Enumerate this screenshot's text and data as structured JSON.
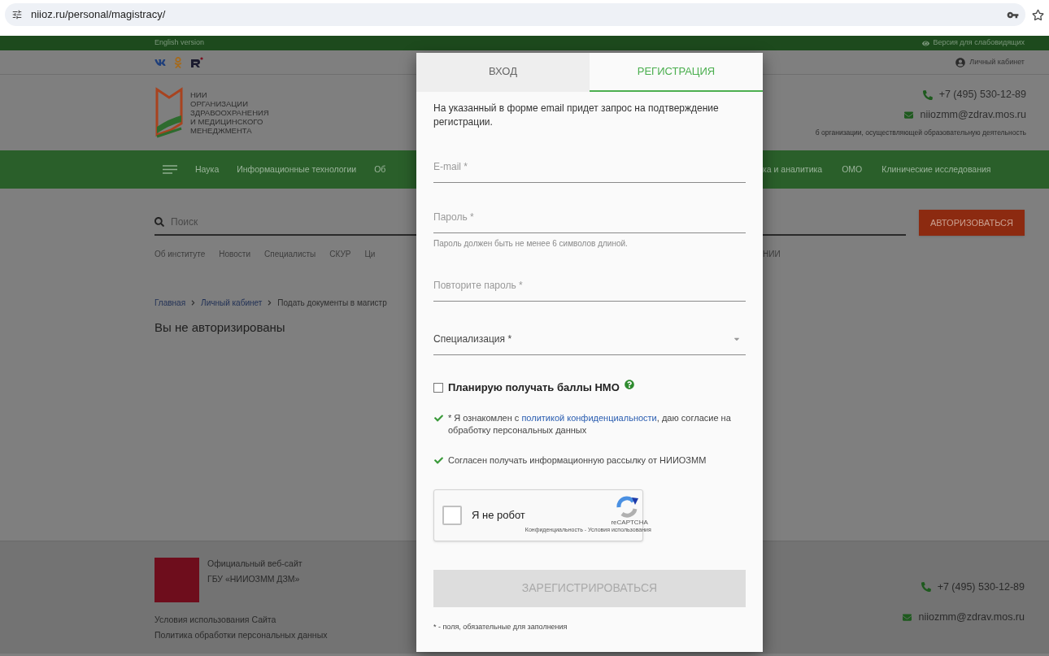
{
  "browser": {
    "url": "niioz.ru/personal/magistracy/"
  },
  "top_bar": {
    "left": "English version",
    "right": "Версия для слабовидящих"
  },
  "social_row": {
    "account_link": "Личный кабинет"
  },
  "header": {
    "logo_lines": [
      "НИИ",
      "ОРГАНИЗАЦИИ",
      "ЗДРАВООХРАНЕНИЯ",
      "И МЕДИЦИНСКОГО",
      "МЕНЕДЖМЕНТА"
    ],
    "phone": "+7 (495) 530-12-89",
    "email": "niiozmm@zdrav.mos.ru",
    "info": "б организации, осуществляющей образовательную деятельность"
  },
  "main_nav": {
    "left": [
      "Наука",
      "Информационные технологии",
      "Об"
    ],
    "right": [
      "ка и аналитика",
      "ОМО",
      "Клинические исследования"
    ]
  },
  "search": {
    "placeholder": "Поиск"
  },
  "auth_button": "АВТОРИЗОВАТЬСЯ",
  "secondary_nav": {
    "left": [
      "Об институте",
      "Новости",
      "Специалисты",
      "СКУР",
      "Ци"
    ],
    "right": [
      "НИИ"
    ]
  },
  "breadcrumbs": [
    {
      "label": "Главная",
      "kind": "link"
    },
    {
      "label": "Личный кабинет",
      "kind": "link"
    },
    {
      "label": "Подать документы в магистр",
      "kind": "current"
    }
  ],
  "page_title": "Вы не авторизированы",
  "footer": {
    "site_lines": [
      "Официальный веб-сайт",
      "ГБУ «НИИОЗММ ДЗМ»"
    ],
    "links": [
      "Условия использования Сайта",
      "Политика обработки персональных данных"
    ],
    "phone": "+7 (495) 530-12-89",
    "email": "niiozmm@zdrav.mos.ru"
  },
  "modal": {
    "tabs": [
      {
        "label": "ВХОД",
        "selected": false
      },
      {
        "label": "РЕГИСТРАЦИЯ",
        "selected": true
      }
    ],
    "intro": "На указанный в форме email придет запрос на подтверждение регистрации.",
    "fields": [
      {
        "kind": "input",
        "placeholder": "E-mail *"
      },
      {
        "kind": "input",
        "placeholder": "Пароль *",
        "hint": "Пароль должен быть не менее 6 символов длиной."
      },
      {
        "kind": "input",
        "placeholder": "Повторите пароль *"
      },
      {
        "kind": "select",
        "label": "Специализация *"
      }
    ],
    "nmo": {
      "label": "Планирую получать баллы НМО",
      "checked": false
    },
    "consents": [
      {
        "before": "* Я ознакомлен с ",
        "link": "политикой конфиденциальности",
        "after": ", даю согласие на обработку персональных данных",
        "checked": true
      },
      {
        "before": "Согласен получать информационную рассылку от НИИОЗММ",
        "checked": true
      }
    ],
    "captcha": {
      "label": "Я не робот",
      "checked": false,
      "brand": "reCAPTCHA",
      "links": "Конфиденциальность - Условия использования"
    },
    "submit": {
      "label": "ЗАРЕГИСТРИРОВАТЬСЯ",
      "disabled": true
    },
    "footnote": "* - поля, обязательные для заполнения"
  }
}
